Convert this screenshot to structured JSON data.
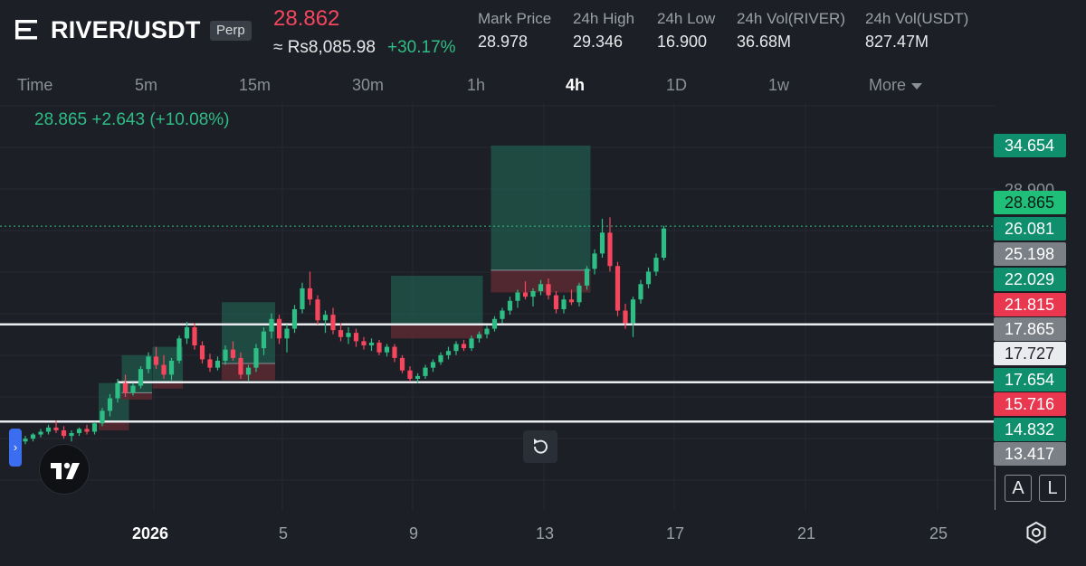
{
  "header": {
    "pair": "RIVER/USDT",
    "contract_type": "Perp",
    "last_price": "28.862",
    "fiat_price": "≈ Rs8,085.98",
    "change_pct": "+30.17%",
    "stats": [
      {
        "label": "Mark Price",
        "value": "28.978"
      },
      {
        "label": "24h High",
        "value": "29.346"
      },
      {
        "label": "24h Low",
        "value": "16.900"
      },
      {
        "label": "24h Vol(RIVER)",
        "value": "36.68M"
      },
      {
        "label": "24h Vol(USDT)",
        "value": "827.47M"
      }
    ]
  },
  "timeframes": {
    "items": [
      "Time",
      "5m",
      "15m",
      "30m",
      "1h",
      "4h",
      "1D",
      "1w"
    ],
    "more": "More",
    "active": "4h"
  },
  "legend": {
    "text": "28.865  +2.643 (+10.08%)"
  },
  "price_scale": {
    "ghost_label": "28.900",
    "labels": [
      {
        "value": "34.654",
        "style": "teal"
      },
      {
        "value": "28.865",
        "style": "green"
      },
      {
        "value": "26.081",
        "style": "teal"
      },
      {
        "value": "25.198",
        "style": "grey"
      },
      {
        "value": "22.029",
        "style": "teal"
      },
      {
        "value": "21.815",
        "style": "red"
      },
      {
        "value": "17.865",
        "style": "grey"
      },
      {
        "value": "17.727",
        "style": "white"
      },
      {
        "value": "17.654",
        "style": "teal"
      },
      {
        "value": "15.716",
        "style": "red"
      },
      {
        "value": "14.832",
        "style": "teal"
      },
      {
        "value": "13.417",
        "style": "grey"
      }
    ],
    "buttons": {
      "auto": "A",
      "log": "L"
    }
  },
  "time_axis": {
    "labels": [
      {
        "text": "2026",
        "bold": true
      },
      {
        "text": "5",
        "bold": false
      },
      {
        "text": "9",
        "bold": false
      },
      {
        "text": "13",
        "bold": false
      },
      {
        "text": "17",
        "bold": false
      },
      {
        "text": "21",
        "bold": false
      },
      {
        "text": "25",
        "bold": false
      }
    ]
  },
  "icons": {
    "menu": "menu-icon",
    "reset": "reset-icon",
    "settings": "settings-icon",
    "logo": "tradingview-logo-icon",
    "handle": "chevron-right-icon"
  },
  "colors": {
    "up": "#2ebd85",
    "down": "#f6465d",
    "background": "#1c1f26",
    "profit_zone": "#1f5a4c",
    "loss_zone": "#5a2a33"
  },
  "chart_data": {
    "type": "candlestick",
    "horizontal_levels": [
      21.815,
      17.654,
      14.832
    ],
    "last_price_line": 28.865,
    "candles": [
      {
        "o": 13.4,
        "h": 13.8,
        "l": 13.2,
        "c": 13.6
      },
      {
        "o": 13.6,
        "h": 14.0,
        "l": 13.4,
        "c": 13.9
      },
      {
        "o": 13.9,
        "h": 14.3,
        "l": 13.7,
        "c": 14.1
      },
      {
        "o": 14.1,
        "h": 14.6,
        "l": 13.9,
        "c": 14.4
      },
      {
        "o": 14.4,
        "h": 14.9,
        "l": 14.0,
        "c": 14.2
      },
      {
        "o": 14.2,
        "h": 14.5,
        "l": 13.6,
        "c": 13.8
      },
      {
        "o": 13.8,
        "h": 14.2,
        "l": 13.4,
        "c": 14.0
      },
      {
        "o": 14.0,
        "h": 14.4,
        "l": 13.8,
        "c": 14.3
      },
      {
        "o": 14.3,
        "h": 14.6,
        "l": 13.9,
        "c": 14.1
      },
      {
        "o": 14.1,
        "h": 14.8,
        "l": 13.9,
        "c": 14.7
      },
      {
        "o": 14.7,
        "h": 15.8,
        "l": 14.5,
        "c": 15.6
      },
      {
        "o": 15.6,
        "h": 16.8,
        "l": 15.2,
        "c": 16.5
      },
      {
        "o": 16.5,
        "h": 17.9,
        "l": 16.2,
        "c": 17.6
      },
      {
        "o": 17.6,
        "h": 18.2,
        "l": 16.6,
        "c": 16.9
      },
      {
        "o": 16.9,
        "h": 17.6,
        "l": 16.7,
        "c": 17.4
      },
      {
        "o": 17.4,
        "h": 18.8,
        "l": 17.2,
        "c": 18.6
      },
      {
        "o": 18.6,
        "h": 19.8,
        "l": 18.3,
        "c": 19.5
      },
      {
        "o": 19.5,
        "h": 20.2,
        "l": 18.6,
        "c": 18.9
      },
      {
        "o": 18.9,
        "h": 19.6,
        "l": 17.9,
        "c": 18.2
      },
      {
        "o": 18.2,
        "h": 19.4,
        "l": 17.8,
        "c": 19.2
      },
      {
        "o": 19.2,
        "h": 21.0,
        "l": 19.0,
        "c": 20.8
      },
      {
        "o": 20.8,
        "h": 22.0,
        "l": 20.4,
        "c": 21.6
      },
      {
        "o": 21.6,
        "h": 21.9,
        "l": 20.0,
        "c": 20.3
      },
      {
        "o": 20.3,
        "h": 20.6,
        "l": 19.0,
        "c": 19.3
      },
      {
        "o": 19.3,
        "h": 19.7,
        "l": 18.4,
        "c": 18.7
      },
      {
        "o": 18.7,
        "h": 19.5,
        "l": 18.5,
        "c": 19.2
      },
      {
        "o": 19.2,
        "h": 20.3,
        "l": 18.9,
        "c": 20.0
      },
      {
        "o": 20.0,
        "h": 20.6,
        "l": 19.2,
        "c": 19.4
      },
      {
        "o": 19.4,
        "h": 19.8,
        "l": 17.9,
        "c": 18.2
      },
      {
        "o": 18.2,
        "h": 18.9,
        "l": 17.7,
        "c": 18.7
      },
      {
        "o": 18.7,
        "h": 20.4,
        "l": 18.4,
        "c": 20.1
      },
      {
        "o": 20.1,
        "h": 21.6,
        "l": 19.6,
        "c": 21.3
      },
      {
        "o": 21.3,
        "h": 22.6,
        "l": 20.8,
        "c": 22.2
      },
      {
        "o": 22.2,
        "h": 22.5,
        "l": 20.4,
        "c": 20.8
      },
      {
        "o": 20.8,
        "h": 21.8,
        "l": 19.8,
        "c": 21.5
      },
      {
        "o": 21.5,
        "h": 23.2,
        "l": 21.2,
        "c": 22.9
      },
      {
        "o": 22.9,
        "h": 24.8,
        "l": 22.6,
        "c": 24.4
      },
      {
        "o": 24.4,
        "h": 25.6,
        "l": 23.2,
        "c": 23.6
      },
      {
        "o": 23.6,
        "h": 23.9,
        "l": 21.8,
        "c": 22.1
      },
      {
        "o": 22.1,
        "h": 22.8,
        "l": 21.2,
        "c": 22.5
      },
      {
        "o": 22.5,
        "h": 23.0,
        "l": 21.1,
        "c": 21.4
      },
      {
        "o": 21.4,
        "h": 21.9,
        "l": 20.6,
        "c": 20.9
      },
      {
        "o": 20.9,
        "h": 21.6,
        "l": 20.4,
        "c": 21.2
      },
      {
        "o": 21.2,
        "h": 21.5,
        "l": 20.2,
        "c": 20.6
      },
      {
        "o": 20.6,
        "h": 20.9,
        "l": 20.0,
        "c": 20.3
      },
      {
        "o": 20.3,
        "h": 20.8,
        "l": 19.9,
        "c": 20.5
      },
      {
        "o": 20.5,
        "h": 20.7,
        "l": 19.6,
        "c": 19.8
      },
      {
        "o": 19.8,
        "h": 20.4,
        "l": 19.5,
        "c": 20.2
      },
      {
        "o": 20.2,
        "h": 20.4,
        "l": 19.1,
        "c": 19.4
      },
      {
        "o": 19.4,
        "h": 19.6,
        "l": 18.3,
        "c": 18.5
      },
      {
        "o": 18.5,
        "h": 18.8,
        "l": 17.7,
        "c": 17.9
      },
      {
        "o": 17.9,
        "h": 18.3,
        "l": 17.6,
        "c": 18.1
      },
      {
        "o": 18.1,
        "h": 18.9,
        "l": 17.9,
        "c": 18.7
      },
      {
        "o": 18.7,
        "h": 19.3,
        "l": 18.4,
        "c": 19.1
      },
      {
        "o": 19.1,
        "h": 19.8,
        "l": 18.9,
        "c": 19.6
      },
      {
        "o": 19.6,
        "h": 20.2,
        "l": 19.3,
        "c": 19.9
      },
      {
        "o": 19.9,
        "h": 20.6,
        "l": 19.6,
        "c": 20.4
      },
      {
        "o": 20.4,
        "h": 20.7,
        "l": 19.9,
        "c": 20.1
      },
      {
        "o": 20.1,
        "h": 21.0,
        "l": 19.9,
        "c": 20.8
      },
      {
        "o": 20.8,
        "h": 21.3,
        "l": 20.5,
        "c": 21.1
      },
      {
        "o": 21.1,
        "h": 21.7,
        "l": 20.8,
        "c": 21.5
      },
      {
        "o": 21.5,
        "h": 22.4,
        "l": 21.3,
        "c": 22.2
      },
      {
        "o": 22.2,
        "h": 23.0,
        "l": 21.9,
        "c": 22.8
      },
      {
        "o": 22.8,
        "h": 23.8,
        "l": 22.5,
        "c": 23.5
      },
      {
        "o": 23.5,
        "h": 24.3,
        "l": 23.0,
        "c": 24.1
      },
      {
        "o": 24.1,
        "h": 24.9,
        "l": 23.6,
        "c": 23.8
      },
      {
        "o": 23.8,
        "h": 24.4,
        "l": 23.1,
        "c": 24.2
      },
      {
        "o": 24.2,
        "h": 25.0,
        "l": 23.9,
        "c": 24.7
      },
      {
        "o": 24.7,
        "h": 25.1,
        "l": 23.6,
        "c": 23.9
      },
      {
        "o": 23.9,
        "h": 24.2,
        "l": 22.6,
        "c": 22.9
      },
      {
        "o": 22.9,
        "h": 23.9,
        "l": 22.6,
        "c": 23.6
      },
      {
        "o": 23.6,
        "h": 24.3,
        "l": 23.2,
        "c": 23.4
      },
      {
        "o": 23.4,
        "h": 24.8,
        "l": 23.1,
        "c": 24.6
      },
      {
        "o": 24.6,
        "h": 26.0,
        "l": 24.3,
        "c": 25.8
      },
      {
        "o": 25.8,
        "h": 27.2,
        "l": 25.4,
        "c": 26.9
      },
      {
        "o": 26.9,
        "h": 29.4,
        "l": 26.6,
        "c": 28.4
      },
      {
        "o": 28.4,
        "h": 29.5,
        "l": 25.6,
        "c": 26.0
      },
      {
        "o": 26.0,
        "h": 26.3,
        "l": 22.4,
        "c": 22.8
      },
      {
        "o": 22.8,
        "h": 23.3,
        "l": 21.5,
        "c": 21.9
      },
      {
        "o": 21.9,
        "h": 23.8,
        "l": 20.9,
        "c": 23.6
      },
      {
        "o": 23.6,
        "h": 25.0,
        "l": 23.3,
        "c": 24.7
      },
      {
        "o": 24.7,
        "h": 25.9,
        "l": 24.4,
        "c": 25.6
      },
      {
        "o": 25.6,
        "h": 26.9,
        "l": 25.3,
        "c": 26.6
      },
      {
        "o": 26.6,
        "h": 28.9,
        "l": 26.4,
        "c": 28.7
      }
    ],
    "position_zones": [
      {
        "start": 10,
        "end": 13,
        "entry": 14.8,
        "target": 17.6,
        "stop": 14.2
      },
      {
        "start": 13,
        "end": 16,
        "entry": 16.9,
        "target": 19.6,
        "stop": 16.4
      },
      {
        "start": 17,
        "end": 20,
        "entry": 17.7,
        "target": 20.2,
        "stop": 17.2
      },
      {
        "start": 26,
        "end": 32,
        "entry": 19.0,
        "target": 23.4,
        "stop": 17.8
      },
      {
        "start": 48,
        "end": 59,
        "entry": 21.8,
        "target": 25.3,
        "stop": 20.8
      },
      {
        "start": 61,
        "end": 73,
        "entry": 25.7,
        "target": 34.654,
        "stop": 24.1
      }
    ]
  }
}
